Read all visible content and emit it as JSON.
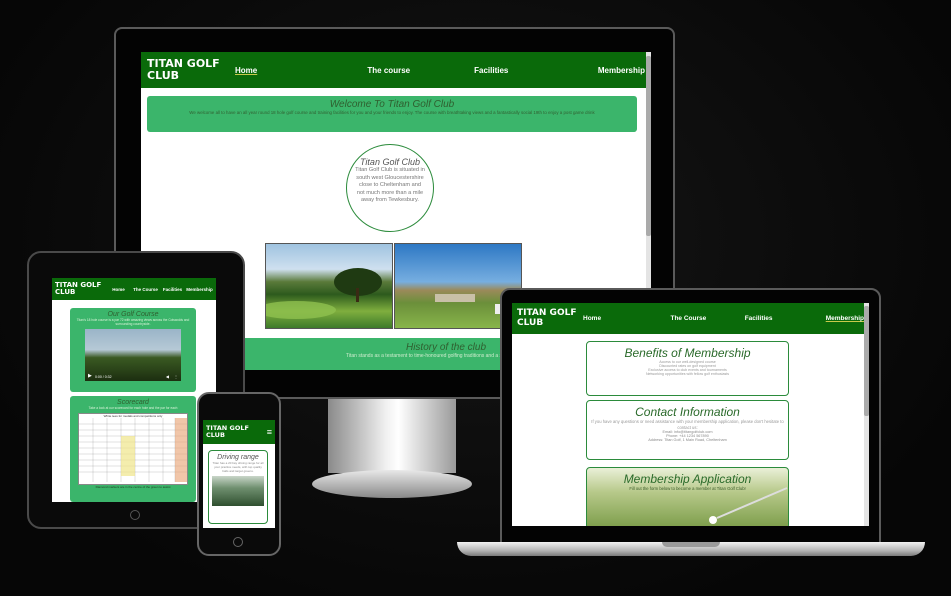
{
  "desktop": {
    "brand_line1": "TITAN GOLF",
    "brand_line2": "CLUB",
    "nav": [
      "Home",
      "The course",
      "Facilities",
      "Membership"
    ],
    "welcome_title": "Welcome To Titan Golf Club",
    "welcome_text": "We welcome all to have an all year round 18 hole golf course and training facilities for you and your friends to enjoy. The course with breathtaking views and a fantastically social 19th to enjoy a post game drink",
    "circle_title": "Titan Golf Club",
    "circle_text": "Titan Golf Club is situated in south west Gloucestershire close to Cheltenham and not much more than a mile away from Tewkesbury.",
    "history_title": "History of the club",
    "history_text": "Titan stands as a testament to time-honoured golfing traditions and a symbol of excellence"
  },
  "tablet": {
    "brand_line1": "TITAN GOLF",
    "brand_line2": "CLUB",
    "nav": [
      "Home",
      "The Course",
      "Facilities",
      "Membership"
    ],
    "course_title": "Our Golf Course",
    "course_text": "Titan's 18 hole course is a par 72 with amazing views across the Cotswolds and surrounding countryside.",
    "video_time": "0:00 / 0:32",
    "scorecard_title": "Scorecard",
    "scorecard_text": "Take a look at our scorecard for each hole and the par for each",
    "table_caption": "White tees for medals and competitions only",
    "scorecard_foot": "Diamond markers are in the centre of the green to assist"
  },
  "phone": {
    "brand_line1": "TITAN GOLF",
    "brand_line2": "CLUB",
    "menu_icon": "hamburger-icon",
    "card_title": "Driving range",
    "card_text": "Titan has a 20 bay driving range for all your practice needs, with top quality balls and target greens."
  },
  "laptop": {
    "brand_line1": "TITAN GOLF",
    "brand_line2": "CLUB",
    "nav": [
      "Home",
      "The Course",
      "Facilities",
      "Membership"
    ],
    "benefits_title": "Benefits of Membership",
    "benefits_lines": [
      "Access to our well-designed course",
      "Discounted rates on golf equipment",
      "Exclusive access to club events and tournaments",
      "Networking opportunities with fellow golf enthusiasts"
    ],
    "contact_title": "Contact Information",
    "contact_text": "If you have any questions or need assistance with your membership application, please don't hesitate to contact us:",
    "contact_email": "Email: info@titangolfclub.com",
    "contact_phone": "Phone: +44 1234 567890",
    "contact_address": "Address: Titan Golf, 1 Main Road, Cheltenham",
    "application_title": "Membership Application",
    "application_text": "Fill out the form below to become a member at Titan Golf Club!"
  },
  "colors": {
    "nav_green": "#0a6a0a",
    "box_green": "#3bb56b",
    "border_green": "#2b8b3b",
    "background": "#0b0b0b"
  }
}
